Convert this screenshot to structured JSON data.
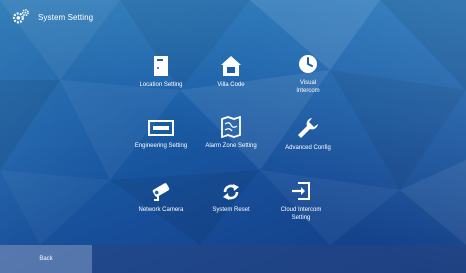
{
  "header": {
    "title": "System Setting",
    "icon": "gear-icon"
  },
  "items": [
    {
      "label": "Location Setting",
      "icon": "door-room-icon"
    },
    {
      "label": "Villa Code",
      "icon": "house-icon"
    },
    {
      "label": "Visual\nIntercom",
      "icon": "clock-circle-icon"
    },
    {
      "label": "Engineering Setting",
      "icon": "keyboard-icon"
    },
    {
      "label": "Alarm Zone Setting",
      "icon": "map-icon"
    },
    {
      "label": "Advanced Config",
      "icon": "wrench-icon"
    },
    {
      "label": "Network Camera",
      "icon": "camera-icon"
    },
    {
      "label": "System Reset",
      "icon": "refresh-icon"
    },
    {
      "label": "Cloud Intercom\nSetting",
      "icon": "sign-in-icon"
    }
  ],
  "footer": {
    "back_label": "Back"
  }
}
